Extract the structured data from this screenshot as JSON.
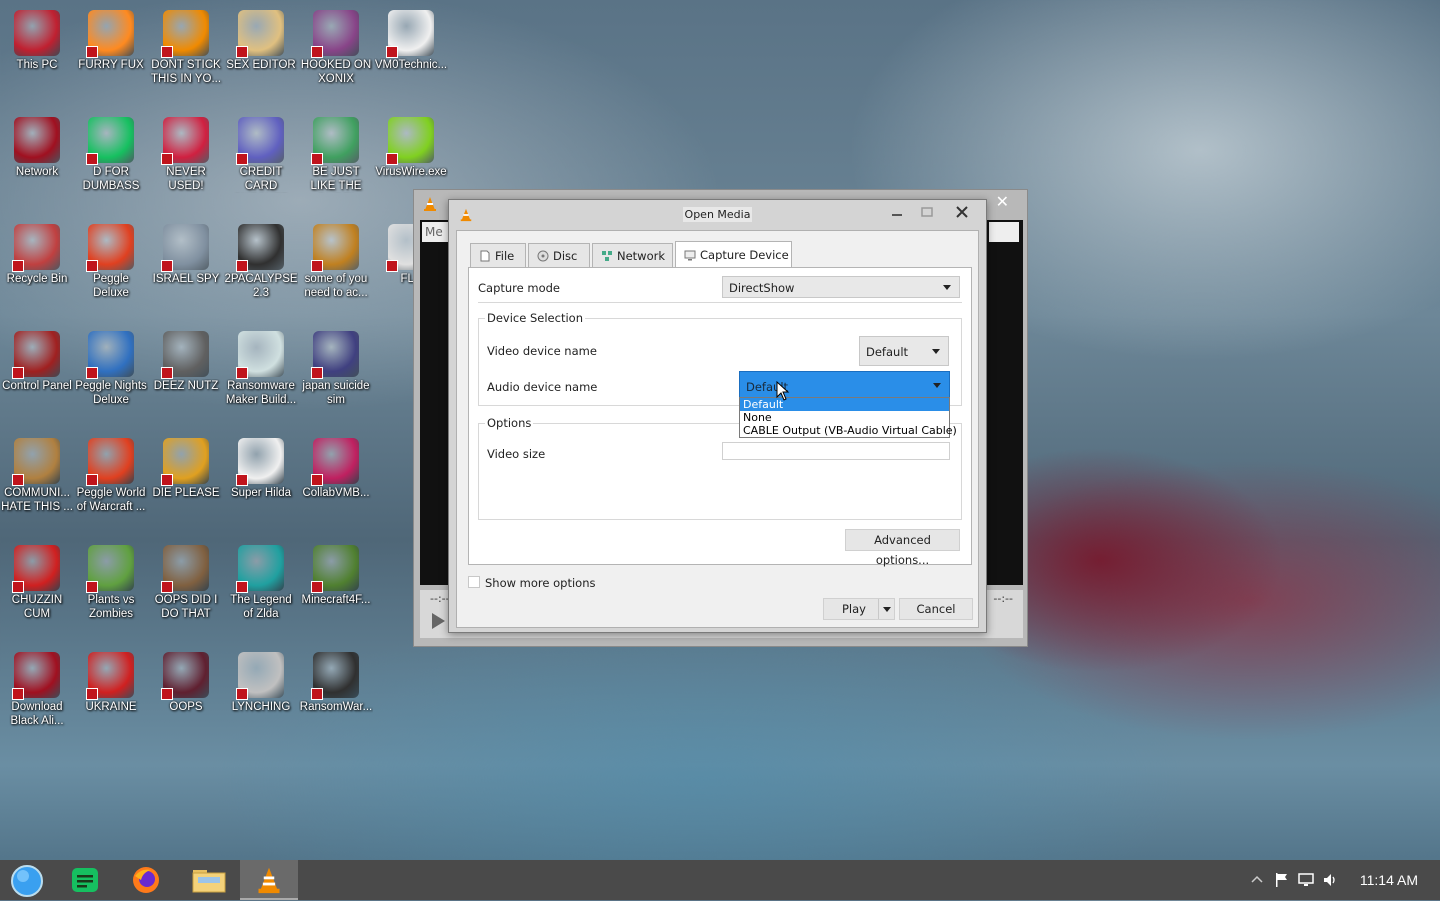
{
  "desktop": {
    "icons": [
      {
        "label": "This PC",
        "icon": "monitor-icon"
      },
      {
        "label": "FURRY FUX",
        "icon": "firefox-icon"
      },
      {
        "label": "DONT STICK THIS IN YO...",
        "icon": "vlc-cone-icon"
      },
      {
        "label": "SEX EDITOR",
        "icon": "hex-editor-icon"
      },
      {
        "label": "HOOKED ON XONIX",
        "icon": "game-icon"
      },
      {
        "label": "VM0Technic...",
        "icon": "doctor-icon"
      },
      {
        "label": "Network",
        "icon": "network-orb-icon"
      },
      {
        "label": "D FOR DUMBASS",
        "icon": "chat-app-icon"
      },
      {
        "label": "NEVER USED!",
        "icon": "devcpp-icon"
      },
      {
        "label": "CREDIT CARD CHECKER",
        "icon": "credit-card-icon"
      },
      {
        "label": "BE JUST LIKE THE DUDE!",
        "icon": "santa-icon"
      },
      {
        "label": "VirusWire.exe",
        "icon": "lime-icon"
      },
      {
        "label": "Recycle Bin",
        "icon": "recycle-bin-icon"
      },
      {
        "label": "Peggle Deluxe",
        "icon": "peggle-icon"
      },
      {
        "label": "ISRAEL SPY",
        "icon": "network-pc-icon"
      },
      {
        "label": "2PACALYPSE 2.3",
        "icon": "terminal-icon"
      },
      {
        "label": "some of you need to ac...",
        "icon": "dog-icon"
      },
      {
        "label": "FLA",
        "icon": "flash-icon"
      },
      {
        "label": "Control Panel",
        "icon": "control-panel-icon"
      },
      {
        "label": "Peggle Nights Deluxe",
        "icon": "peggle-nights-icon"
      },
      {
        "label": "DEEZ NUTZ",
        "icon": "windows-stack-icon"
      },
      {
        "label": "Ransomware Maker Build...",
        "icon": "builder-icon"
      },
      {
        "label": "japan suicide sim",
        "icon": "japan-sim-icon"
      },
      {
        "label": "COMMUNI... HATE THIS ...",
        "icon": "money-bag-icon"
      },
      {
        "label": "Peggle World of Warcraft ...",
        "icon": "peggle-wow-icon"
      },
      {
        "label": "DIE PLEASE",
        "icon": "de-icon"
      },
      {
        "label": "Super Hilda",
        "icon": "pixel-cat-icon"
      },
      {
        "label": "CollabVMB...",
        "icon": "collabvm-icon"
      },
      {
        "label": "CHUZZIN CUM",
        "icon": "chuzzle-icon"
      },
      {
        "label": "Plants vs Zombies",
        "icon": "plants-icon"
      },
      {
        "label": "OOPS DID I DO THAT",
        "icon": "portrait-icon"
      },
      {
        "label": "The Legend of Zlda",
        "icon": "pixel-hero-icon"
      },
      {
        "label": "Minecraft4F...",
        "icon": "grass-block-icon"
      },
      {
        "label": "Download Black Ali...",
        "icon": "network-orb-icon"
      },
      {
        "label": "UKRAINE",
        "icon": "radiation-icon"
      },
      {
        "label": "OOPS",
        "icon": "dark-book-icon"
      },
      {
        "label": "LYNCHING",
        "icon": "lynching-icon"
      },
      {
        "label": "RansomWar...",
        "icon": "skull-icon"
      }
    ]
  },
  "vlc_main": {
    "partial_text": "Me",
    "time_left": "--:--",
    "time_right": "--:--"
  },
  "dialog": {
    "title": "Open Media",
    "tabs": [
      {
        "label": "File",
        "icon": "file-icon"
      },
      {
        "label": "Disc",
        "icon": "disc-icon"
      },
      {
        "label": "Network",
        "icon": "network-icon"
      },
      {
        "label": "Capture Device",
        "icon": "capture-device-icon"
      }
    ],
    "capture_mode_label": "Capture mode",
    "capture_mode_value": "DirectShow",
    "device_selection_title": "Device Selection",
    "video_device_label": "Video device name",
    "video_device_value": "Default",
    "audio_device_label": "Audio device name",
    "audio_device_value": "Default",
    "audio_device_options": [
      "Default",
      "None",
      "CABLE Output (VB-Audio Virtual Cable)"
    ],
    "options_title": "Options",
    "video_size_label": "Video size",
    "video_size_value": "",
    "advanced_options_label": "Advanced options...",
    "show_more_options_label": "Show more options",
    "show_more_options_checked": false,
    "play_label": "Play",
    "cancel_label": "Cancel"
  },
  "taskbar": {
    "items": [
      {
        "name": "start-orb-icon"
      },
      {
        "name": "chat-app-icon"
      },
      {
        "name": "firefox-icon"
      },
      {
        "name": "file-explorer-icon"
      },
      {
        "name": "vlc-cone-icon",
        "active": true
      }
    ],
    "clock": "11:14 AM"
  },
  "colors": {
    "accent": "#2a8ee8",
    "taskbar": "#4a4a4a"
  }
}
